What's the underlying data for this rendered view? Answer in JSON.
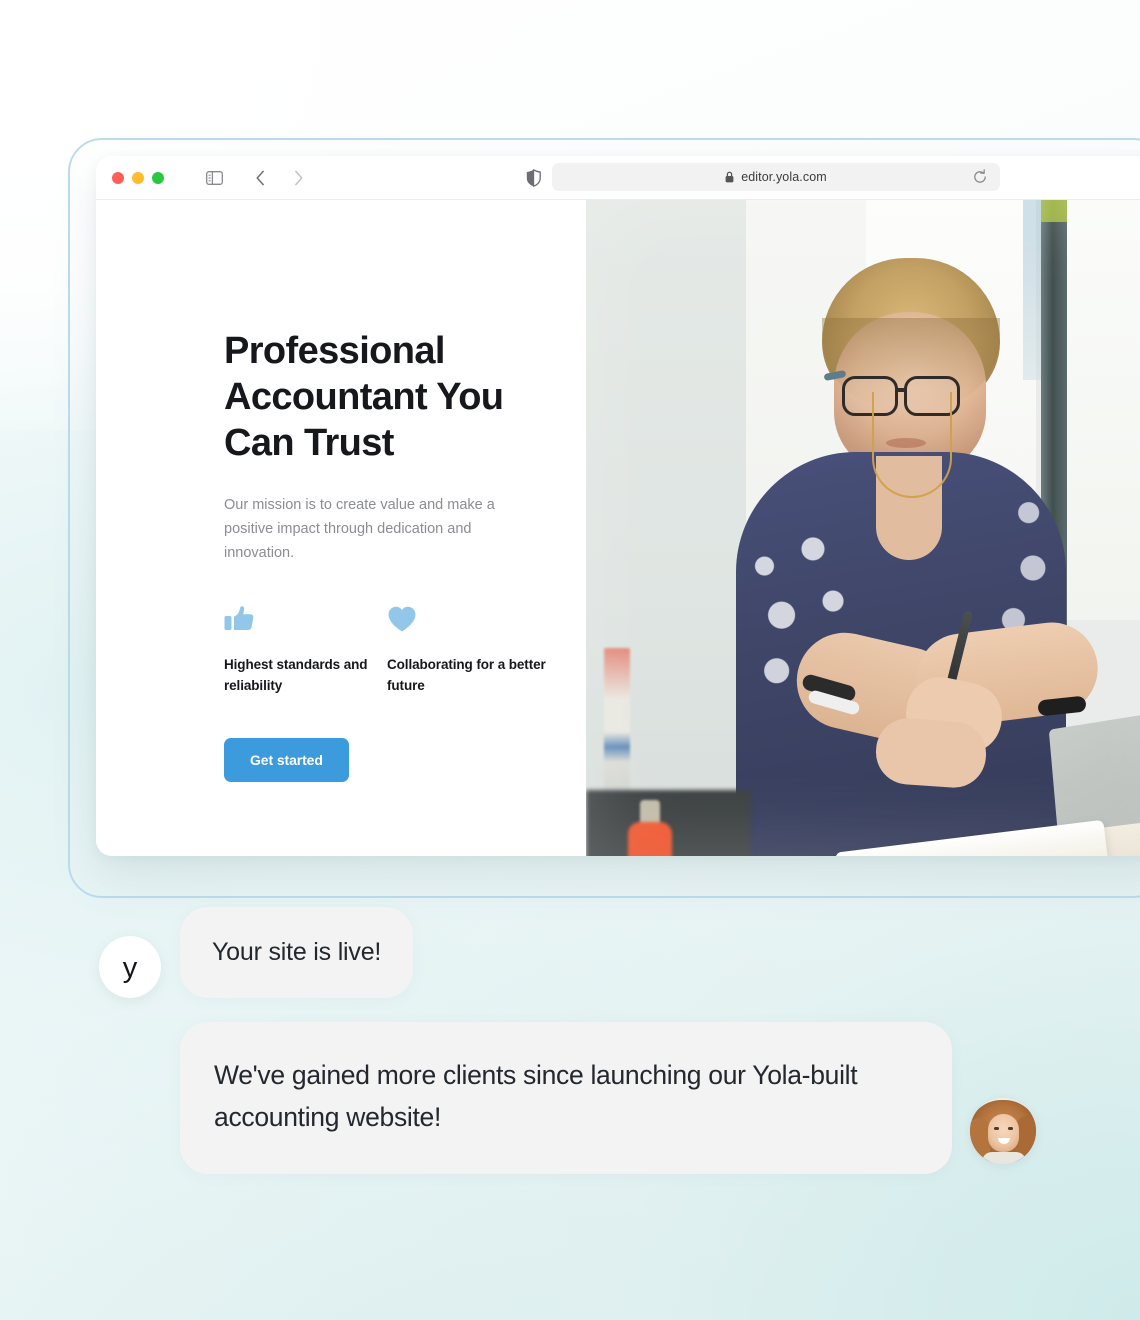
{
  "browser": {
    "traffic_lights": [
      "close",
      "minimize",
      "maximize"
    ],
    "sidebar_toggle_icon": "sidebar-icon",
    "back_icon": "chevron-left-icon",
    "forward_icon": "chevron-right-icon",
    "shield_icon": "shield-icon",
    "lock_icon": "lock-icon",
    "url": "editor.yola.com",
    "reload_icon": "reload-icon"
  },
  "hero": {
    "title": "Professional Accountant You Can Trust",
    "subtitle": "Our mission is to create value and make a positive impact through dedication and innovation.",
    "features": [
      {
        "icon": "thumbs-up-icon",
        "label": "Highest standards and reliability"
      },
      {
        "icon": "heart-icon",
        "label": "Collaborating for a better future"
      }
    ],
    "cta_label": "Get started",
    "photo_alt": "Accountant working at a desk with papers and a laptop"
  },
  "chat": {
    "brand_initial": "y",
    "messages": [
      {
        "from": "yola",
        "text": "Your site is live!"
      },
      {
        "from": "client",
        "text": "We've gained more clients since launching our Yola-built accounting website!"
      }
    ],
    "client_avatar_alt": "Smiling client portrait"
  },
  "colors": {
    "cta_blue": "#3b9bdd",
    "feature_icon_blue": "#93c7ea",
    "bubble_gray": "#f3f3f3",
    "heading_dark": "#17181c",
    "body_gray": "#8b8d92",
    "frame_border": "#bcdcee",
    "traffic_red": "#ff5f57",
    "traffic_yellow": "#febc2e",
    "traffic_green": "#28c840"
  }
}
